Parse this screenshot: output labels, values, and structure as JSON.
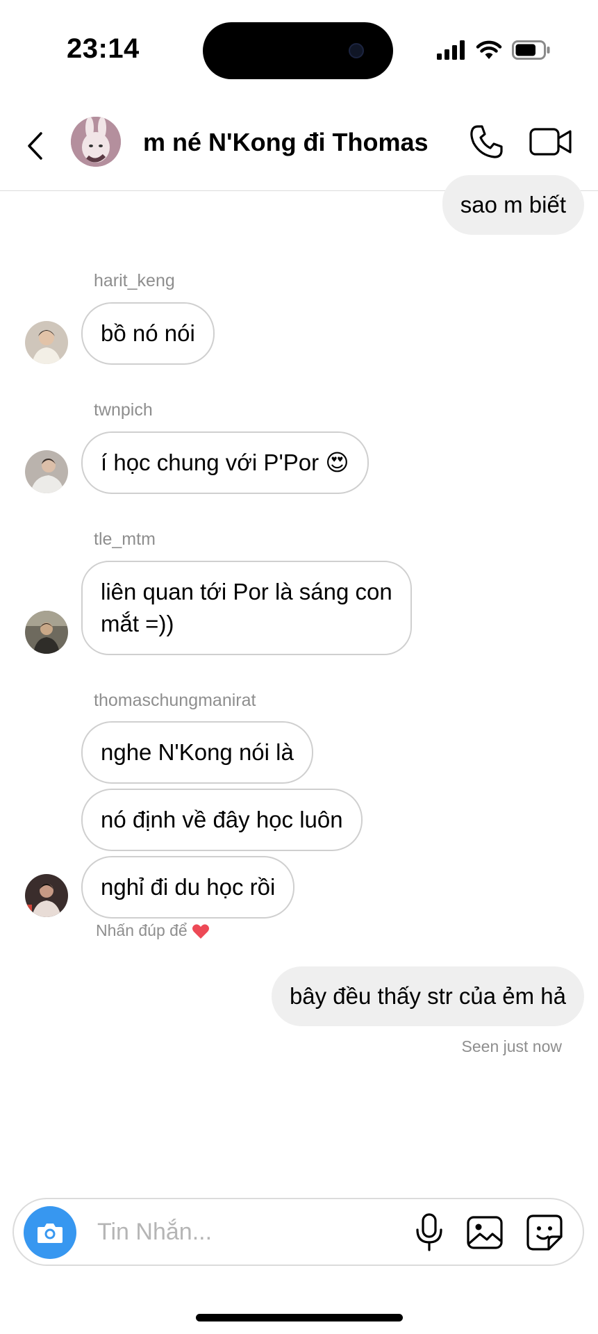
{
  "status_bar": {
    "time": "23:14",
    "battery_level": 0.75
  },
  "header": {
    "title": "m né N'Kong đi Thomas",
    "icons": [
      "chevron-left-icon",
      "phone-icon",
      "video-camera-icon"
    ]
  },
  "messages": [
    {
      "direction": "outgoing",
      "text": "sao m biết"
    },
    {
      "direction": "incoming",
      "sender": "harit_keng",
      "text": "bồ nó nói"
    },
    {
      "direction": "incoming",
      "sender": "twnpich",
      "text": "í học chung với P'Por 😍"
    },
    {
      "direction": "incoming",
      "sender": "tle_mtm",
      "line1": "liên quan tới Por là sáng con",
      "line2": "mắt =))"
    },
    {
      "direction": "incoming",
      "sender": "thomaschungmanirat",
      "text": "nghe N'Kong nói là"
    },
    {
      "direction": "incoming",
      "text": "nó định về đây học luôn"
    },
    {
      "direction": "incoming",
      "text": "nghỉ đi du học rồi"
    },
    {
      "direction": "outgoing",
      "text": "bây đều thấy str của ẻm hả"
    }
  ],
  "double_tap_hint": "Nhấn đúp để",
  "seen_status": "Seen just now",
  "composer": {
    "placeholder": "Tin Nhắn..."
  },
  "colors": {
    "accent": "#3797f0",
    "outgoing_bubble": "#efefef",
    "incoming_border": "#cfcfcf",
    "secondary_text": "#8e8e8e",
    "heart": "#ed4956"
  }
}
